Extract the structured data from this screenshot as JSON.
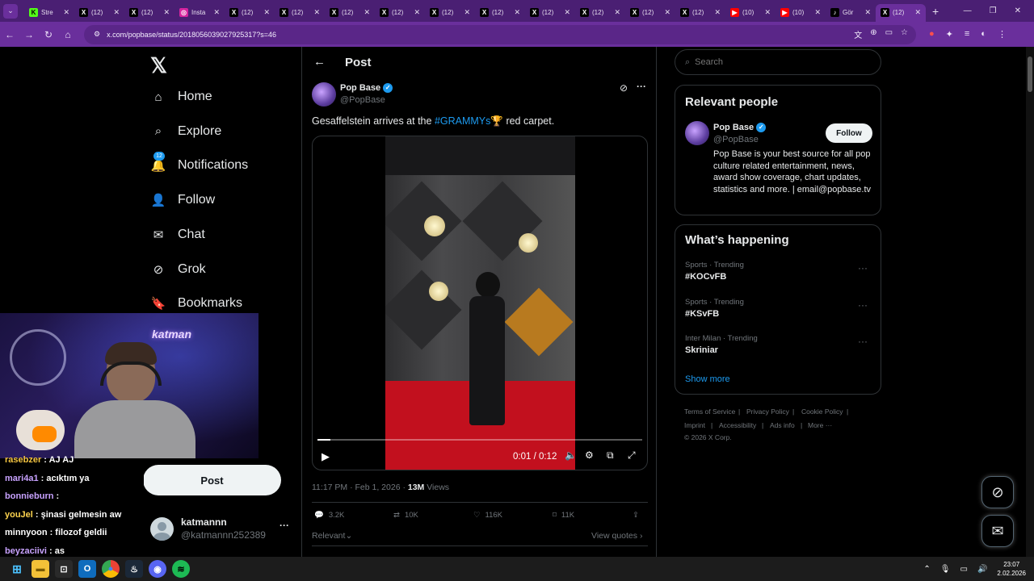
{
  "browser": {
    "tabs": [
      {
        "label": "Stre",
        "fav": "K",
        "color": "#53fc18",
        "fg": "#000"
      },
      {
        "label": "(12)",
        "fav": "X",
        "color": "#000",
        "fg": "#fff"
      },
      {
        "label": "(12)",
        "fav": "X",
        "color": "#000",
        "fg": "#fff"
      },
      {
        "label": "Insta",
        "fav": "◎",
        "color": "#d6249f",
        "fg": "#fff"
      },
      {
        "label": "(12)",
        "fav": "X",
        "color": "#000",
        "fg": "#fff"
      },
      {
        "label": "(12)",
        "fav": "X",
        "color": "#000",
        "fg": "#fff"
      },
      {
        "label": "(12)",
        "fav": "X",
        "color": "#000",
        "fg": "#fff"
      },
      {
        "label": "(12)",
        "fav": "X",
        "color": "#000",
        "fg": "#fff"
      },
      {
        "label": "(12)",
        "fav": "X",
        "color": "#000",
        "fg": "#fff"
      },
      {
        "label": "(12)",
        "fav": "X",
        "color": "#000",
        "fg": "#fff"
      },
      {
        "label": "(12)",
        "fav": "X",
        "color": "#000",
        "fg": "#fff"
      },
      {
        "label": "(12)",
        "fav": "X",
        "color": "#000",
        "fg": "#fff"
      },
      {
        "label": "(12)",
        "fav": "X",
        "color": "#000",
        "fg": "#fff"
      },
      {
        "label": "(12)",
        "fav": "X",
        "color": "#000",
        "fg": "#fff"
      },
      {
        "label": "(10)",
        "fav": "▶",
        "color": "#ff0000",
        "fg": "#fff"
      },
      {
        "label": "(10)",
        "fav": "▶",
        "color": "#ff0000",
        "fg": "#fff"
      },
      {
        "label": "Gör",
        "fav": "♪",
        "color": "#000",
        "fg": "#fff"
      },
      {
        "label": "(12)",
        "fav": "X",
        "color": "#000",
        "fg": "#fff",
        "active": true
      }
    ],
    "url": "x.com/popbase/status/2018056039027925317?s=46"
  },
  "nav": {
    "items": [
      {
        "label": "Home",
        "icon": "home-icon"
      },
      {
        "label": "Explore",
        "icon": "search-icon"
      },
      {
        "label": "Notifications",
        "icon": "bell-icon",
        "badge": "12"
      },
      {
        "label": "Follow",
        "icon": "person-add-icon"
      },
      {
        "label": "Chat",
        "icon": "mail-icon"
      },
      {
        "label": "Grok",
        "icon": "grok-icon"
      },
      {
        "label": "Bookmarks",
        "icon": "bookmark-icon"
      }
    ],
    "post_button": "Post",
    "account": {
      "name": "katmannn",
      "handle": "@katmannn252389"
    }
  },
  "stream": {
    "overlay_text": "katman",
    "chat": [
      {
        "user": "rasebzer",
        "msg": "AJ AJ",
        "color": "#f5c542"
      },
      {
        "user": "mari4a1",
        "msg": "acıktım ya",
        "color": "#c8a2ff"
      },
      {
        "user": "bonnieburn",
        "msg": "",
        "color": "#c8a2ff"
      },
      {
        "user": "youJel",
        "msg": "şinasi gelmesin aw",
        "color": "#ffd54f"
      },
      {
        "user": "minnyoon",
        "msg": "filozof geldii",
        "color": "#ffffff"
      },
      {
        "user": "beyzaciivi",
        "msg": "as",
        "color": "#c8a2ff"
      }
    ]
  },
  "post": {
    "header": "Post",
    "author": {
      "name": "Pop Base",
      "handle": "@PopBase"
    },
    "text_before": "Gesaffelstein arrives at the ",
    "hashtag": "#GRAMMYs",
    "text_after": " red carpet.",
    "video": {
      "time": "0:01 / 0:12",
      "progress": 0.04
    },
    "meta": {
      "time": "11:17 PM · Feb 1, 2026 · ",
      "views_count": "13M",
      "views_label": " Views"
    },
    "stats": {
      "replies": "3.2K",
      "reposts": "10K",
      "likes": "116K",
      "bookmarks": "11K"
    },
    "sort_label": "Relevant",
    "view_quotes": "View quotes"
  },
  "sidebar": {
    "search_placeholder": "Search",
    "relevant_title": "Relevant people",
    "person": {
      "name": "Pop Base",
      "handle": "@PopBase",
      "follow": "Follow",
      "bio": "Pop Base is your best source for all pop culture related entertainment, news, award show coverage, chart updates, statistics and more. | email@popbase.tv"
    },
    "happening_title": "What’s happening",
    "trends": [
      {
        "category": "Sports · Trending",
        "name": "#KOCvFB"
      },
      {
        "category": "Sports · Trending",
        "name": "#KSvFB"
      },
      {
        "category": "Inter Milan · Trending",
        "name": "Skriniar"
      }
    ],
    "show_more": "Show more",
    "footer": {
      "terms": "Terms of Service",
      "privacy": "Privacy Policy",
      "cookie": "Cookie Policy",
      "imprint": "Imprint",
      "accessibility": "Accessibility",
      "ads": "Ads info",
      "more": "More ···",
      "copyright": "© 2026 X Corp."
    }
  },
  "taskbar": {
    "time": "23:07",
    "date": "2.02.2026"
  }
}
